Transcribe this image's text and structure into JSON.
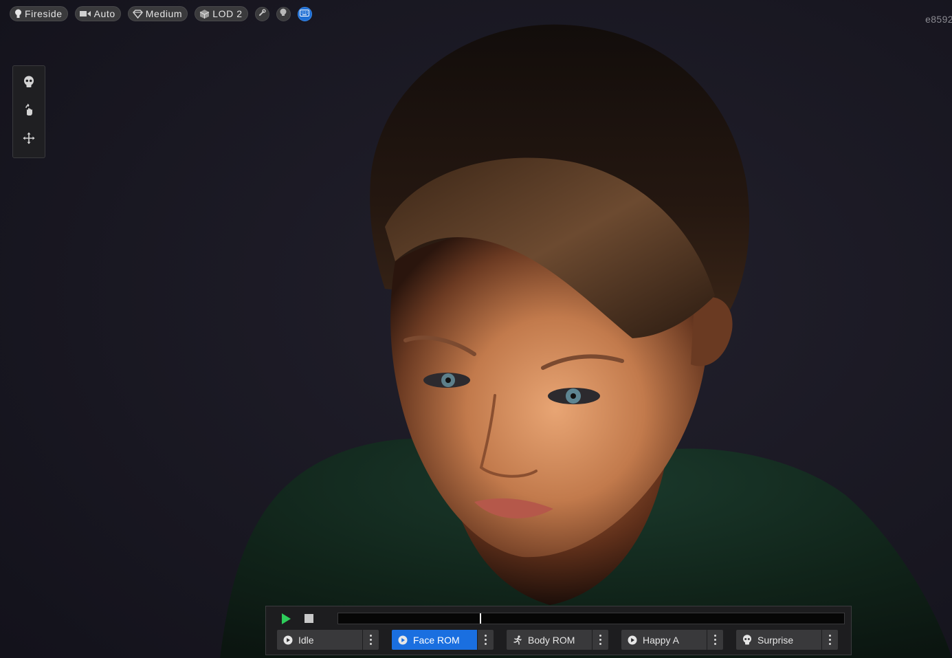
{
  "toolbar": {
    "lighting": {
      "label": "Fireside",
      "icon": "lightbulb-icon"
    },
    "camera": {
      "label": "Auto",
      "icon": "camera-icon"
    },
    "quality": {
      "label": "Medium",
      "icon": "diamond-icon"
    },
    "lod": {
      "label": "LOD 2",
      "icon": "cube-icon"
    },
    "round_buttons": [
      {
        "icon": "wrench-icon",
        "active": false
      },
      {
        "icon": "head-icon",
        "active": false
      },
      {
        "icon": "keyboard-icon",
        "active": true
      }
    ]
  },
  "corner_id": "e8592",
  "tools": [
    {
      "icon": "skull-icon"
    },
    {
      "icon": "rotate-hand-icon"
    },
    {
      "icon": "move-icon"
    }
  ],
  "player": {
    "play_icon": "play-icon",
    "stop_icon": "stop-icon",
    "playhead_fraction": 0.28
  },
  "clips": [
    {
      "label": "Idle",
      "icon": "play-circle-icon",
      "selected": false
    },
    {
      "label": "Face ROM",
      "icon": "play-circle-icon",
      "selected": true
    },
    {
      "label": "Body ROM",
      "icon": "running-figure-icon",
      "selected": false
    },
    {
      "label": "Happy A",
      "icon": "play-circle-icon",
      "selected": false
    },
    {
      "label": "Surprise",
      "icon": "skull-icon",
      "selected": false
    }
  ],
  "colors": {
    "accent": "#1a6fe0",
    "play_green": "#2ecc5a",
    "background": "#161521"
  }
}
